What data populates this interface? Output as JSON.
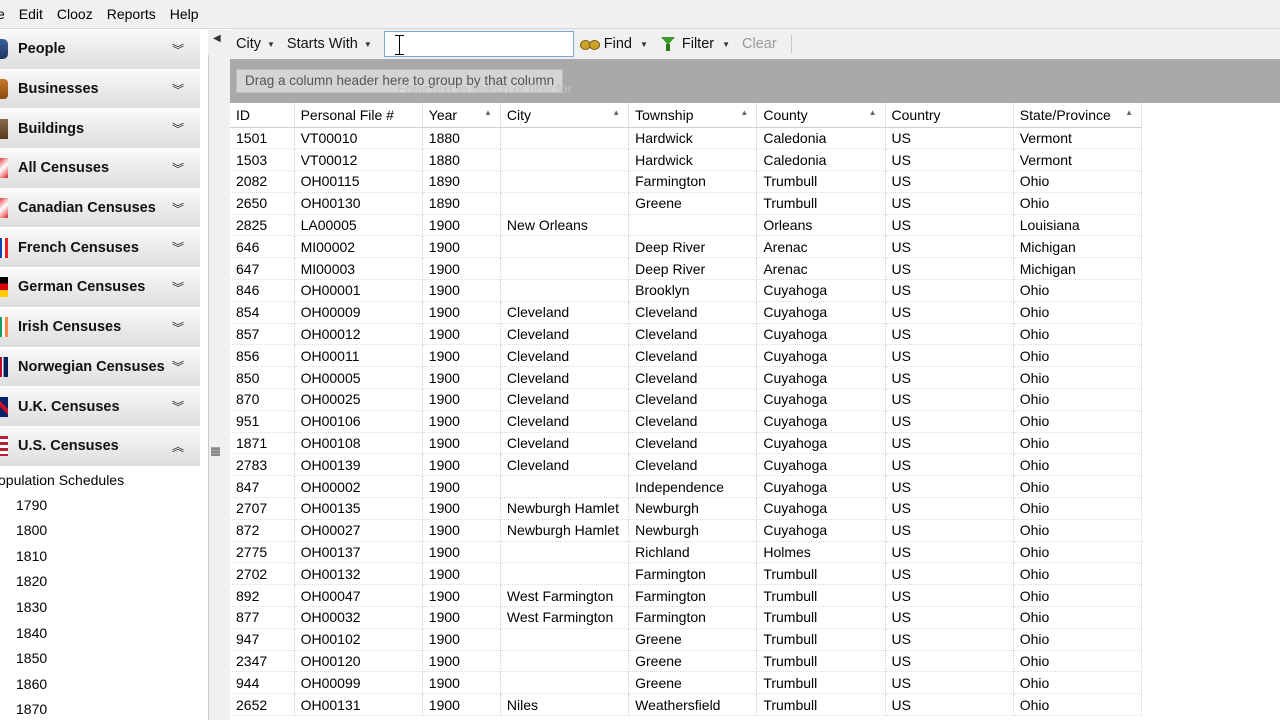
{
  "menu": [
    "e",
    "Edit",
    "Clooz",
    "Reports",
    "Help"
  ],
  "nav": {
    "groups": [
      {
        "label": "People",
        "icon": "people-icon",
        "expanded": false
      },
      {
        "label": "Businesses",
        "icon": "business-icon",
        "expanded": false
      },
      {
        "label": "Buildings",
        "icon": "building-icon",
        "expanded": false
      },
      {
        "label": "All Censuses",
        "icon": "census-icon",
        "expanded": false
      },
      {
        "label": "Canadian Censuses",
        "icon": "canada-flag-icon",
        "expanded": false
      },
      {
        "label": "French Censuses",
        "icon": "france-flag-icon",
        "expanded": false
      },
      {
        "label": "German Censuses",
        "icon": "germany-flag-icon",
        "expanded": false
      },
      {
        "label": "Irish Censuses",
        "icon": "ireland-flag-icon",
        "expanded": false
      },
      {
        "label": "Norwegian Censuses",
        "icon": "norway-flag-icon",
        "expanded": false
      },
      {
        "label": "U.K. Censuses",
        "icon": "uk-flag-icon",
        "expanded": false
      },
      {
        "label": "U.S. Censuses",
        "icon": "us-flag-icon",
        "expanded": true
      }
    ],
    "sub_title": "opulation Schedules",
    "years": [
      "1790",
      "1800",
      "1810",
      "1820",
      "1830",
      "1840",
      "1850",
      "1860",
      "1870"
    ]
  },
  "toolbar": {
    "field": "City",
    "operator": "Starts With",
    "search_value": "",
    "find": "Find",
    "filter": "Filter",
    "clear": "Clear"
  },
  "groupby": {
    "hint": "Drag a column header here to group by that column",
    "ghost": "Enter text to search or filter for"
  },
  "grid": {
    "columns": [
      "ID",
      "Personal File #",
      "Year",
      "City",
      "Township",
      "County",
      "Country",
      "State/Province"
    ],
    "rows": [
      [
        "1501",
        "VT00010",
        "1880",
        "",
        "Hardwick",
        "Caledonia",
        "US",
        "Vermont"
      ],
      [
        "1503",
        "VT00012",
        "1880",
        "",
        "Hardwick",
        "Caledonia",
        "US",
        "Vermont"
      ],
      [
        "2082",
        "OH00115",
        "1890",
        "",
        "Farmington",
        "Trumbull",
        "US",
        "Ohio"
      ],
      [
        "2650",
        "OH00130",
        "1890",
        "",
        "Greene",
        "Trumbull",
        "US",
        "Ohio"
      ],
      [
        "2825",
        "LA00005",
        "1900",
        "New Orleans",
        "",
        "Orleans",
        "US",
        "Louisiana"
      ],
      [
        "646",
        "MI00002",
        "1900",
        "",
        "Deep River",
        "Arenac",
        "US",
        "Michigan"
      ],
      [
        "647",
        "MI00003",
        "1900",
        "",
        "Deep River",
        "Arenac",
        "US",
        "Michigan"
      ],
      [
        "846",
        "OH00001",
        "1900",
        "",
        "Brooklyn",
        "Cuyahoga",
        "US",
        "Ohio"
      ],
      [
        "854",
        "OH00009",
        "1900",
        "Cleveland",
        "Cleveland",
        "Cuyahoga",
        "US",
        "Ohio"
      ],
      [
        "857",
        "OH00012",
        "1900",
        "Cleveland",
        "Cleveland",
        "Cuyahoga",
        "US",
        "Ohio"
      ],
      [
        "856",
        "OH00011",
        "1900",
        "Cleveland",
        "Cleveland",
        "Cuyahoga",
        "US",
        "Ohio"
      ],
      [
        "850",
        "OH00005",
        "1900",
        "Cleveland",
        "Cleveland",
        "Cuyahoga",
        "US",
        "Ohio"
      ],
      [
        "870",
        "OH00025",
        "1900",
        "Cleveland",
        "Cleveland",
        "Cuyahoga",
        "US",
        "Ohio"
      ],
      [
        "951",
        "OH00106",
        "1900",
        "Cleveland",
        "Cleveland",
        "Cuyahoga",
        "US",
        "Ohio"
      ],
      [
        "1871",
        "OH00108",
        "1900",
        "Cleveland",
        "Cleveland",
        "Cuyahoga",
        "US",
        "Ohio"
      ],
      [
        "2783",
        "OH00139",
        "1900",
        "Cleveland",
        "Cleveland",
        "Cuyahoga",
        "US",
        "Ohio"
      ],
      [
        "847",
        "OH00002",
        "1900",
        "",
        "Independence",
        "Cuyahoga",
        "US",
        "Ohio"
      ],
      [
        "2707",
        "OH00135",
        "1900",
        "Newburgh Hamlet",
        "Newburgh",
        "Cuyahoga",
        "US",
        "Ohio"
      ],
      [
        "872",
        "OH00027",
        "1900",
        "Newburgh Hamlet",
        "Newburgh",
        "Cuyahoga",
        "US",
        "Ohio"
      ],
      [
        "2775",
        "OH00137",
        "1900",
        "",
        "Richland",
        "Holmes",
        "US",
        "Ohio"
      ],
      [
        "2702",
        "OH00132",
        "1900",
        "",
        "Farmington",
        "Trumbull",
        "US",
        "Ohio"
      ],
      [
        "892",
        "OH00047",
        "1900",
        "West Farmington",
        "Farmington",
        "Trumbull",
        "US",
        "Ohio"
      ],
      [
        "877",
        "OH00032",
        "1900",
        "West Farmington",
        "Farmington",
        "Trumbull",
        "US",
        "Ohio"
      ],
      [
        "947",
        "OH00102",
        "1900",
        "",
        "Greene",
        "Trumbull",
        "US",
        "Ohio"
      ],
      [
        "2347",
        "OH00120",
        "1900",
        "",
        "Greene",
        "Trumbull",
        "US",
        "Ohio"
      ],
      [
        "944",
        "OH00099",
        "1900",
        "",
        "Greene",
        "Trumbull",
        "US",
        "Ohio"
      ],
      [
        "2652",
        "OH00131",
        "1900",
        "Niles",
        "Weathersfield",
        "Trumbull",
        "US",
        "Ohio"
      ]
    ]
  }
}
